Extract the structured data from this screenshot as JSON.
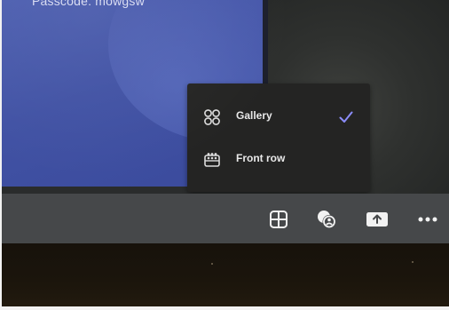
{
  "share": {
    "passcode_text": "Passcode: mowgsw"
  },
  "layout_menu": {
    "items": [
      {
        "label": "Gallery",
        "icon": "gallery-icon",
        "selected": true
      },
      {
        "label": "Front row",
        "icon": "front-row-icon",
        "selected": false
      }
    ],
    "check_color": "#8b8cf8"
  },
  "control_bar": {
    "buttons": [
      {
        "icon": "grid-layout-icon"
      },
      {
        "icon": "background-effects-icon"
      },
      {
        "icon": "share-screen-icon"
      },
      {
        "icon": "more-options-icon"
      }
    ]
  },
  "colors": {
    "share_background": "#4152a4",
    "menu_background": "#242423",
    "control_bar": "#46484a"
  }
}
